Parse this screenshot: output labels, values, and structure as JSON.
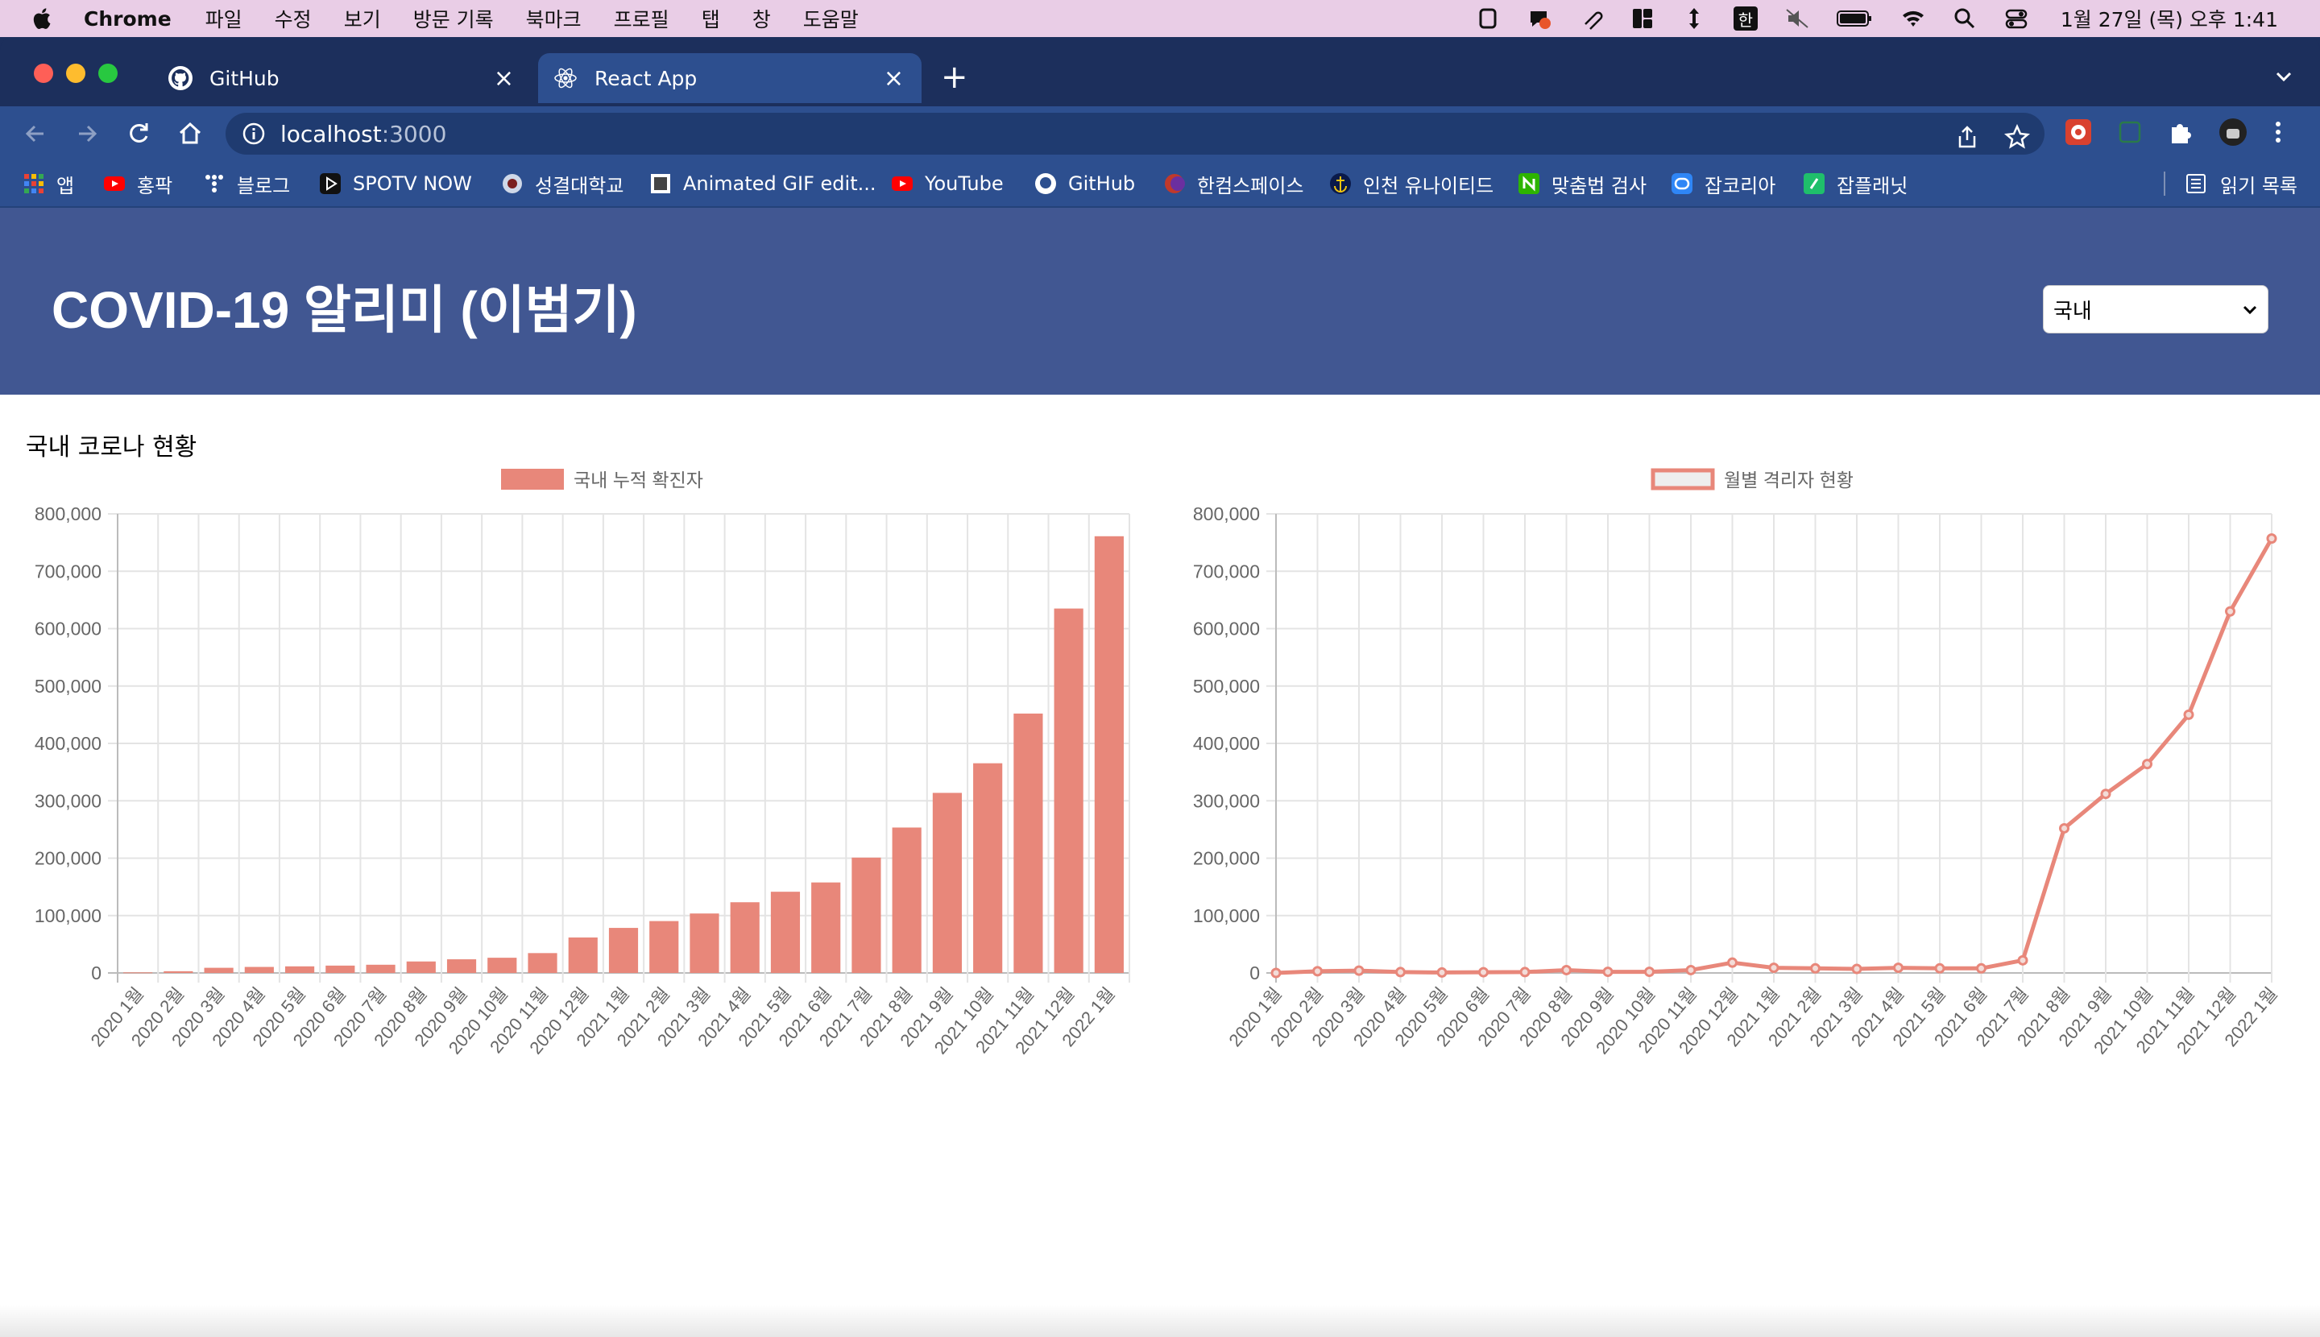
{
  "menubar": {
    "app_name": "Chrome",
    "items": [
      "파일",
      "수정",
      "보기",
      "방문 기록",
      "북마크",
      "프로필",
      "탭",
      "창",
      "도움말"
    ],
    "clock": "1월 27일 (목) 오후 1:41",
    "ime_label": "한"
  },
  "tabs": [
    {
      "title": "GitHub",
      "icon": "github-icon",
      "active": false
    },
    {
      "title": "React App",
      "icon": "react-icon",
      "active": true
    }
  ],
  "omnibox": {
    "host": "localhost",
    "port": ":3000"
  },
  "bookmarks": [
    {
      "label": "앱",
      "icon": "apps-grid-icon",
      "color": "#e94235"
    },
    {
      "label": "홍팍",
      "icon": "youtube-icon",
      "color": "#ff0000"
    },
    {
      "label": "블로그",
      "icon": "blog-icon",
      "color": "#ffffff"
    },
    {
      "label": "SPOTV NOW",
      "icon": "play-icon",
      "color": "#111111"
    },
    {
      "label": "성결대학교",
      "icon": "university-icon",
      "color": "#cfd8e8"
    },
    {
      "label": "Animated GIF edit...",
      "icon": "gif-icon",
      "color": "#444444"
    },
    {
      "label": "YouTube",
      "icon": "youtube-icon",
      "color": "#ff0000"
    },
    {
      "label": "GitHub",
      "icon": "github-icon",
      "color": "#ffffff"
    },
    {
      "label": "한컴스페이스",
      "icon": "hancom-icon",
      "color": "#c0392b"
    },
    {
      "label": "인천 유나이티드",
      "icon": "anchor-icon",
      "color": "#0a1a4a"
    },
    {
      "label": "맞춤법 검사",
      "icon": "spellcheck-icon",
      "color": "#2db400"
    },
    {
      "label": "잡코리아",
      "icon": "jobkorea-icon",
      "color": "#2f86f6"
    },
    {
      "label": "잡플래닛",
      "icon": "jobplanet-icon",
      "color": "#1fbf6b"
    }
  ],
  "reading_list": "읽기 목록",
  "app": {
    "title": "COVID-19 알리미 (이범기)",
    "region_select": "국내",
    "section_title": "국내 코로나 현황"
  },
  "chart_data": [
    {
      "type": "bar",
      "legend": "국내 누적 확진자",
      "color": "#e8877a",
      "categories": [
        "2020 1월",
        "2020 2월",
        "2020 3월",
        "2020 4월",
        "2020 5월",
        "2020 6월",
        "2020 7월",
        "2020 8월",
        "2020 9월",
        "2020 10월",
        "2020 11월",
        "2020 12월",
        "2021 1월",
        "2021 2월",
        "2021 3월",
        "2021 4월",
        "2021 5월",
        "2021 6월",
        "2021 7월",
        "2021 8월",
        "2021 9월",
        "2021 10월",
        "2021 11월",
        "2021 12월",
        "2022 1월"
      ],
      "values": [
        1000,
        3000,
        9000,
        10500,
        11500,
        12800,
        14300,
        20000,
        23800,
        26500,
        34600,
        61800,
        78500,
        90400,
        103600,
        123200,
        141500,
        157700,
        201000,
        253400,
        313800,
        365400,
        452000,
        635000,
        761000
      ],
      "ylim": [
        0,
        800000
      ],
      "yticks": [
        "0",
        "100,000",
        "200,000",
        "300,000",
        "400,000",
        "500,000",
        "600,000",
        "700,000",
        "800,000"
      ],
      "grid": true,
      "legend_position": "top"
    },
    {
      "type": "line",
      "legend": "월별 격리자 현황",
      "color": "#e8877a",
      "categories": [
        "2020 1월",
        "2020 2월",
        "2020 3월",
        "2020 4월",
        "2020 5월",
        "2020 6월",
        "2020 7월",
        "2020 8월",
        "2020 9월",
        "2020 10월",
        "2020 11월",
        "2020 12월",
        "2021 1월",
        "2021 2월",
        "2021 3월",
        "2021 4월",
        "2021 5월",
        "2021 6월",
        "2021 7월",
        "2021 8월",
        "2021 9월",
        "2021 10월",
        "2021 11월",
        "2021 12월",
        "2022 1월"
      ],
      "values": [
        0,
        3000,
        4000,
        1500,
        800,
        1300,
        1500,
        5000,
        2000,
        2000,
        5000,
        18000,
        9000,
        8000,
        7000,
        9000,
        8000,
        8000,
        22000,
        252000,
        312000,
        364000,
        450000,
        630000,
        757000
      ],
      "ylim": [
        0,
        800000
      ],
      "yticks": [
        "0",
        "100,000",
        "200,000",
        "300,000",
        "400,000",
        "500,000",
        "600,000",
        "700,000",
        "800,000"
      ],
      "grid": true,
      "legend_position": "top"
    }
  ]
}
